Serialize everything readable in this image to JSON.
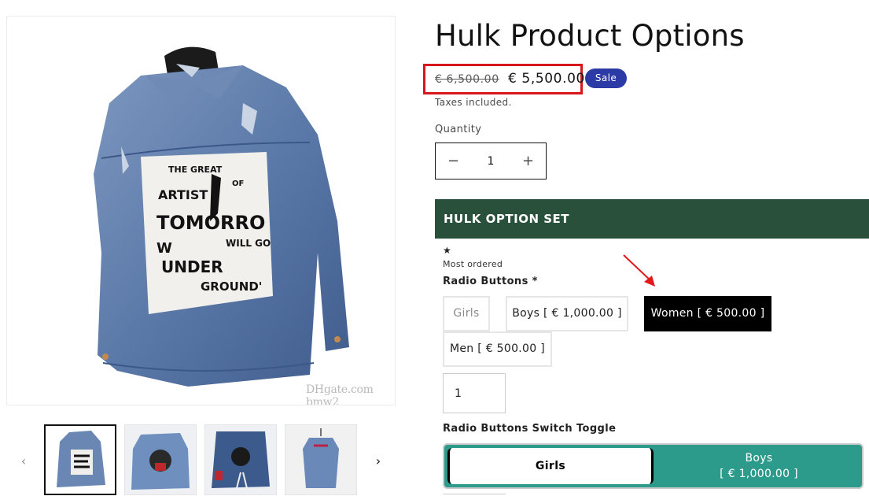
{
  "gallery": {
    "watermark": "DHgate.com bmw2",
    "prev_icon": "‹",
    "next_icon": "›",
    "jacket_patch_lines": [
      "THE GREAT",
      "ARTIST",
      "OF",
      "TOMORRO",
      "W",
      "WILL GO",
      "UNDER",
      "GROUND'"
    ]
  },
  "product": {
    "title": "Hulk Product Options",
    "compare_price": "€ 6,500.00",
    "sale_price": "€ 5,500.00",
    "badge": "Sale",
    "tax_note": "Taxes included.",
    "quantity_label": "Quantity",
    "quantity_value": "1",
    "minus": "−",
    "plus": "+"
  },
  "options": {
    "header": "HULK OPTION SET",
    "star": "★",
    "most_ordered": "Most ordered",
    "radio_label": "Radio Buttons *",
    "radio_items": [
      {
        "label": "Girls"
      },
      {
        "label": "Boys [ € 1,000.00 ]"
      },
      {
        "label": "Women [ € 500.00 ]"
      },
      {
        "label": "Men [ € 500.00 ]"
      }
    ],
    "number_value": "1",
    "toggle_label": "Radio Buttons Switch Toggle",
    "toggle_items": [
      {
        "label": "Girls"
      },
      {
        "label": "Boys",
        "price": "[ € 1,000.00 ]"
      }
    ]
  },
  "colors": {
    "header_bg": "#28503a",
    "sale_badge": "#2b3aa5",
    "highlight": "#d8161c",
    "toggle_bg": "#2c9b8c"
  }
}
